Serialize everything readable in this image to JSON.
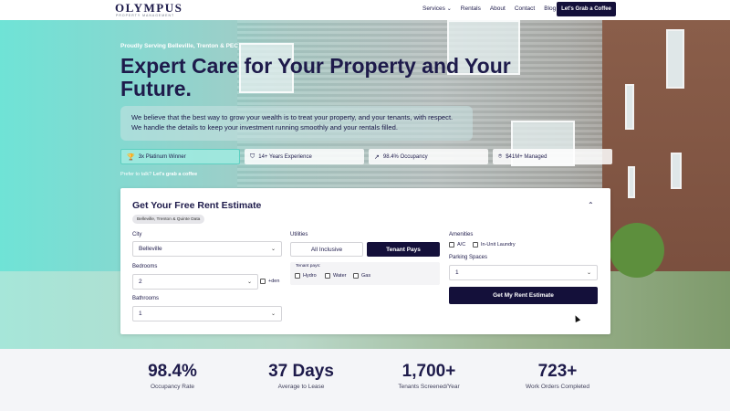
{
  "nav": {
    "logo_main": "OLYMPUS",
    "logo_sub": "PROPERTY MANAGEMENT",
    "links": [
      "Services",
      "Rentals",
      "About",
      "Contact",
      "Blog"
    ],
    "services_caret": "⌄",
    "cta": "Let's Grab a Coffee"
  },
  "hero": {
    "tagline": "Proudly Serving Belleville, Trenton & PEC",
    "headline": "Expert Care for Your Property and Your Future.",
    "intro": "We believe that the best way to grow your wealth is to treat your property, and your tenants, with respect. We handle the details to keep your investment running smoothly and your rentals filled.",
    "badges": [
      {
        "icon": "trophy-icon",
        "glyph": "🏆",
        "label": "3x Platinum Winner",
        "active": true
      },
      {
        "icon": "shield-icon",
        "glyph": "⛉",
        "label": "14+ Years Experience",
        "active": false
      },
      {
        "icon": "trend-up-icon",
        "glyph": "↗",
        "label": "98.4% Occupancy",
        "active": false
      },
      {
        "icon": "location-pin-icon",
        "glyph": "⌾",
        "label": "$41M+ Managed",
        "active": false
      }
    ],
    "prefer_text": "Prefer to talk?",
    "prefer_link": "Let's grab a coffee"
  },
  "estimate": {
    "title": "Get Your Free Rent Estimate",
    "collapse_glyph": "⌃",
    "pill": "Belleville, Trenton & Quinte Data",
    "city_label": "City",
    "city_value": "Belleville",
    "bedrooms_label": "Bedrooms",
    "bedrooms_value": "2",
    "den_label": "+den",
    "bathrooms_label": "Bathrooms",
    "bathrooms_value": "1",
    "utilities_label": "Utilities",
    "utilities_options": [
      "All Inclusive",
      "Tenant Pays"
    ],
    "utilities_selected": "Tenant Pays",
    "tenant_pays_label": "Tenant pays:",
    "tenant_pays_items": [
      "Hydro",
      "Water",
      "Gas"
    ],
    "amenities_label": "Amenities",
    "amenities_items": [
      "A/C",
      "In-Unit Laundry"
    ],
    "parking_label": "Parking Spaces",
    "parking_value": "1",
    "submit": "Get My Rent Estimate",
    "select_chevron": "⌄"
  },
  "stats": [
    {
      "value": "98.4%",
      "label": "Occupancy Rate"
    },
    {
      "value": "37 Days",
      "label": "Average to Lease"
    },
    {
      "value": "1,700+",
      "label": "Tenants Screened/Year"
    },
    {
      "value": "723+",
      "label": "Work Orders Completed"
    }
  ],
  "colors": {
    "navy": "#14103a",
    "teal": "#6fe3d6",
    "text": "#1e1b4b"
  }
}
